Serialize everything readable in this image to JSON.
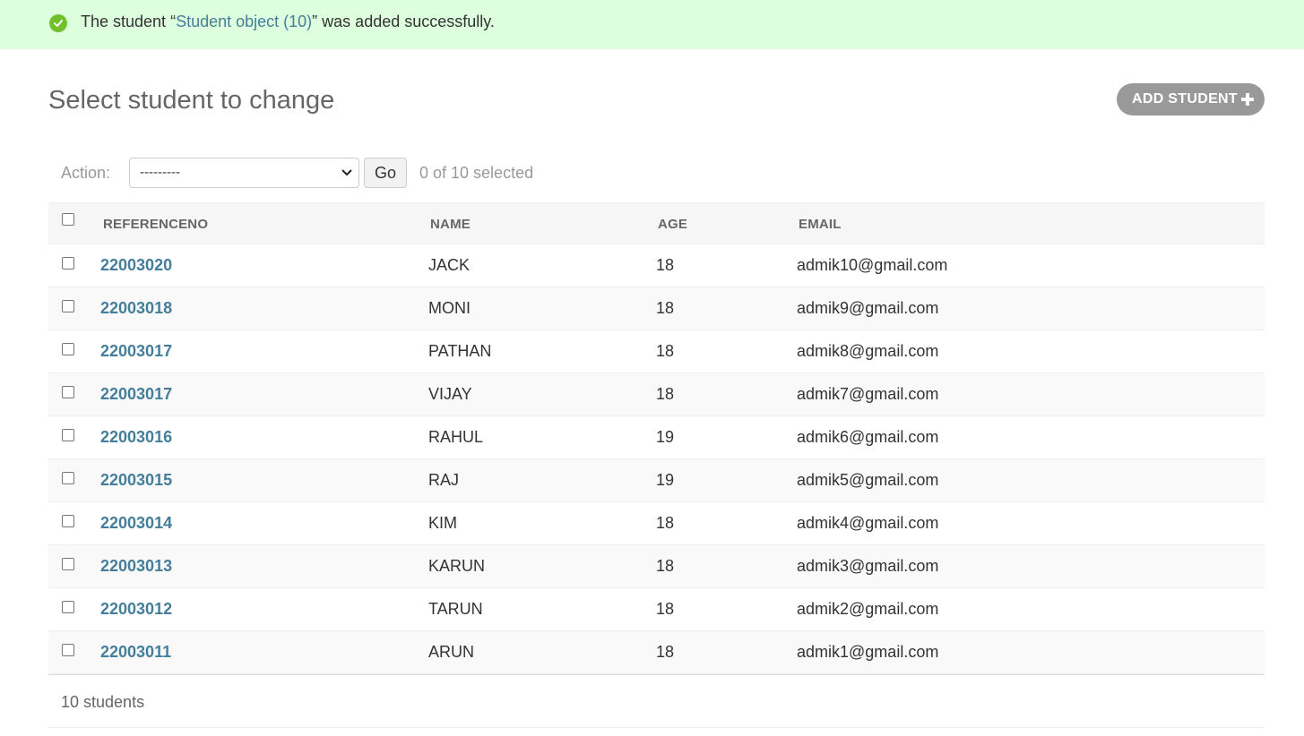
{
  "message": {
    "prefix": "The student “",
    "link_text": "Student object (10)",
    "suffix": "” was added successfully."
  },
  "page_title": "Select student to change",
  "add_button_label": "ADD STUDENT",
  "actions": {
    "label": "Action:",
    "selected_option": "---------",
    "go_label": "Go",
    "selection_count": "0 of 10 selected"
  },
  "columns": [
    "REFERENCENO",
    "NAME",
    "AGE",
    "EMAIL"
  ],
  "rows": [
    {
      "ref": "22003020",
      "name": "JACK",
      "age": "18",
      "email": "admik10@gmail.com"
    },
    {
      "ref": "22003018",
      "name": "MONI",
      "age": "18",
      "email": "admik9@gmail.com"
    },
    {
      "ref": "22003017",
      "name": "PATHAN",
      "age": "18",
      "email": "admik8@gmail.com"
    },
    {
      "ref": "22003017",
      "name": "VIJAY",
      "age": "18",
      "email": "admik7@gmail.com"
    },
    {
      "ref": "22003016",
      "name": "RAHUL",
      "age": "19",
      "email": "admik6@gmail.com"
    },
    {
      "ref": "22003015",
      "name": "RAJ",
      "age": "19",
      "email": "admik5@gmail.com"
    },
    {
      "ref": "22003014",
      "name": "KIM",
      "age": "18",
      "email": "admik4@gmail.com"
    },
    {
      "ref": "22003013",
      "name": "KARUN",
      "age": "18",
      "email": "admik3@gmail.com"
    },
    {
      "ref": "22003012",
      "name": "TARUN",
      "age": "18",
      "email": "admik2@gmail.com"
    },
    {
      "ref": "22003011",
      "name": "ARUN",
      "age": "18",
      "email": "admik1@gmail.com"
    }
  ],
  "paginator_text": "10 students",
  "colors": {
    "success_bg": "#ddffdd",
    "link": "#447e9b",
    "button_gray": "#999999"
  },
  "icons": {
    "message": "check-circle-icon",
    "add": "plus-icon",
    "select": "chevron-down-icon"
  }
}
